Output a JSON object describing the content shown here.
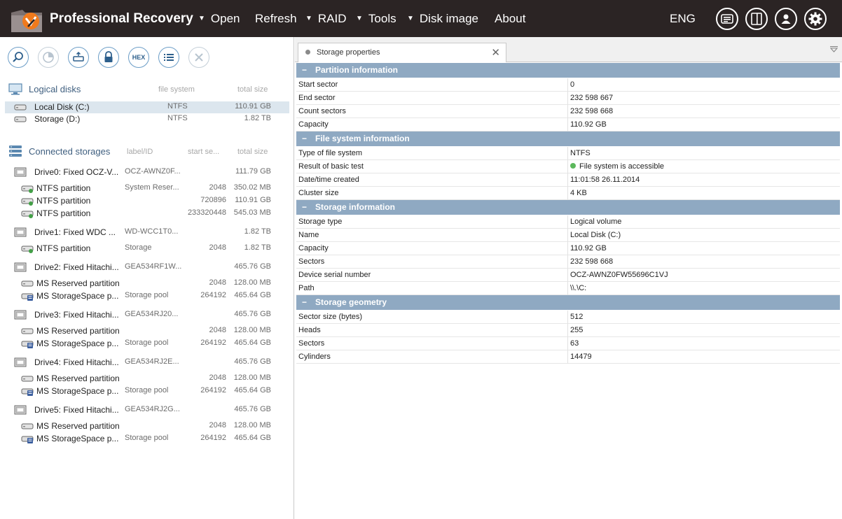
{
  "app": {
    "title": "Professional Recovery"
  },
  "menu": {
    "open": "Open",
    "refresh": "Refresh",
    "raid": "RAID",
    "tools": "Tools",
    "disk_image": "Disk image",
    "about": "About",
    "language": "ENG"
  },
  "header_icons": [
    "messages-icon",
    "panel-toggle-icon",
    "user-icon",
    "gear-icon"
  ],
  "toolbar_icons": [
    "search-icon",
    "scan-icon",
    "image-icon",
    "lock-icon",
    "hex-icon",
    "list-icon",
    "close-icon"
  ],
  "toolbar": {
    "hex_label": "HEX"
  },
  "logical_disks": {
    "title": "Logical disks",
    "col_fs": "file system",
    "col_size": "total size",
    "items": [
      {
        "name": "Local Disk (C:)",
        "fs": "NTFS",
        "size": "110.91 GB",
        "selected": true
      },
      {
        "name": "Storage (D:)",
        "fs": "NTFS",
        "size": "1.82 TB",
        "selected": false
      }
    ]
  },
  "connected_storages": {
    "title": "Connected storages",
    "col_label": "label/ID",
    "col_start": "start se...",
    "col_size": "total size",
    "drives": [
      {
        "name": "Drive0: Fixed OCZ-V...",
        "label": "OCZ-AWNZ0F...",
        "size": "111.79 GB",
        "partitions": [
          {
            "name": "NTFS partition",
            "label": "System Reser...",
            "start": "2048",
            "size": "350.02 MB"
          },
          {
            "name": "NTFS partition",
            "label": "",
            "start": "720896",
            "size": "110.91 GB"
          },
          {
            "name": "NTFS partition",
            "label": "",
            "start": "233320448",
            "size": "545.03 MB"
          }
        ]
      },
      {
        "name": "Drive1: Fixed WDC ...",
        "label": "WD-WCC1T0...",
        "size": "1.82 TB",
        "partitions": [
          {
            "name": "NTFS partition",
            "label": "Storage",
            "start": "2048",
            "size": "1.82 TB"
          }
        ]
      },
      {
        "name": "Drive2: Fixed Hitachi...",
        "label": "GEA534RF1W...",
        "size": "465.76 GB",
        "partitions": [
          {
            "name": "MS Reserved partition",
            "label": "",
            "start": "2048",
            "size": "128.00 MB"
          },
          {
            "name": "MS StorageSpace p...",
            "label": "Storage pool",
            "start": "264192",
            "size": "465.64 GB"
          }
        ]
      },
      {
        "name": "Drive3: Fixed Hitachi...",
        "label": "GEA534RJ20...",
        "size": "465.76 GB",
        "partitions": [
          {
            "name": "MS Reserved partition",
            "label": "",
            "start": "2048",
            "size": "128.00 MB"
          },
          {
            "name": "MS StorageSpace p...",
            "label": "Storage pool",
            "start": "264192",
            "size": "465.64 GB"
          }
        ]
      },
      {
        "name": "Drive4: Fixed Hitachi...",
        "label": "GEA534RJ2E...",
        "size": "465.76 GB",
        "partitions": [
          {
            "name": "MS Reserved partition",
            "label": "",
            "start": "2048",
            "size": "128.00 MB"
          },
          {
            "name": "MS StorageSpace p...",
            "label": "Storage pool",
            "start": "264192",
            "size": "465.64 GB"
          }
        ]
      },
      {
        "name": "Drive5: Fixed Hitachi...",
        "label": "GEA534RJ2G...",
        "size": "465.76 GB",
        "partitions": [
          {
            "name": "MS Reserved partition",
            "label": "",
            "start": "2048",
            "size": "128.00 MB"
          },
          {
            "name": "MS StorageSpace p...",
            "label": "Storage pool",
            "start": "264192",
            "size": "465.64 GB"
          }
        ]
      }
    ]
  },
  "properties_tab": {
    "label": "Storage properties"
  },
  "groups": [
    {
      "title": "Partition information",
      "rows": [
        {
          "key": "Start sector",
          "value": "0"
        },
        {
          "key": "End sector",
          "value": "232 598 667"
        },
        {
          "key": "Count sectors",
          "value": "232 598 668"
        },
        {
          "key": "Capacity",
          "value": "110.92 GB"
        }
      ]
    },
    {
      "title": "File system information",
      "rows": [
        {
          "key": "Type of file system",
          "value": "NTFS"
        },
        {
          "key": "Result of basic test",
          "value": "File system is accessible",
          "status": "ok"
        },
        {
          "key": "Date/time created",
          "value": "11:01:58 26.11.2014"
        },
        {
          "key": "Cluster size",
          "value": "4 KB"
        }
      ]
    },
    {
      "title": "Storage information",
      "rows": [
        {
          "key": "Storage type",
          "value": "Logical volume"
        },
        {
          "key": "Name",
          "value": "Local Disk (C:)"
        },
        {
          "key": "Capacity",
          "value": "110.92 GB"
        },
        {
          "key": "Sectors",
          "value": "232 598 668"
        },
        {
          "key": "Device serial number",
          "value": "OCZ-AWNZ0FW55696C1VJ"
        },
        {
          "key": "Path",
          "value": "\\\\.\\C:"
        }
      ]
    },
    {
      "title": "Storage geometry",
      "rows": [
        {
          "key": "Sector size (bytes)",
          "value": "512"
        },
        {
          "key": "Heads",
          "value": "255"
        },
        {
          "key": "Sectors",
          "value": "63"
        },
        {
          "key": "Cylinders",
          "value": "14479"
        }
      ]
    }
  ],
  "colors": {
    "title_bar": "#2b2424",
    "group_header": "#8fa9c2",
    "selection": "#dce6ee",
    "accent_orange": "#f07a1c",
    "ok_green": "#5cb85c"
  }
}
